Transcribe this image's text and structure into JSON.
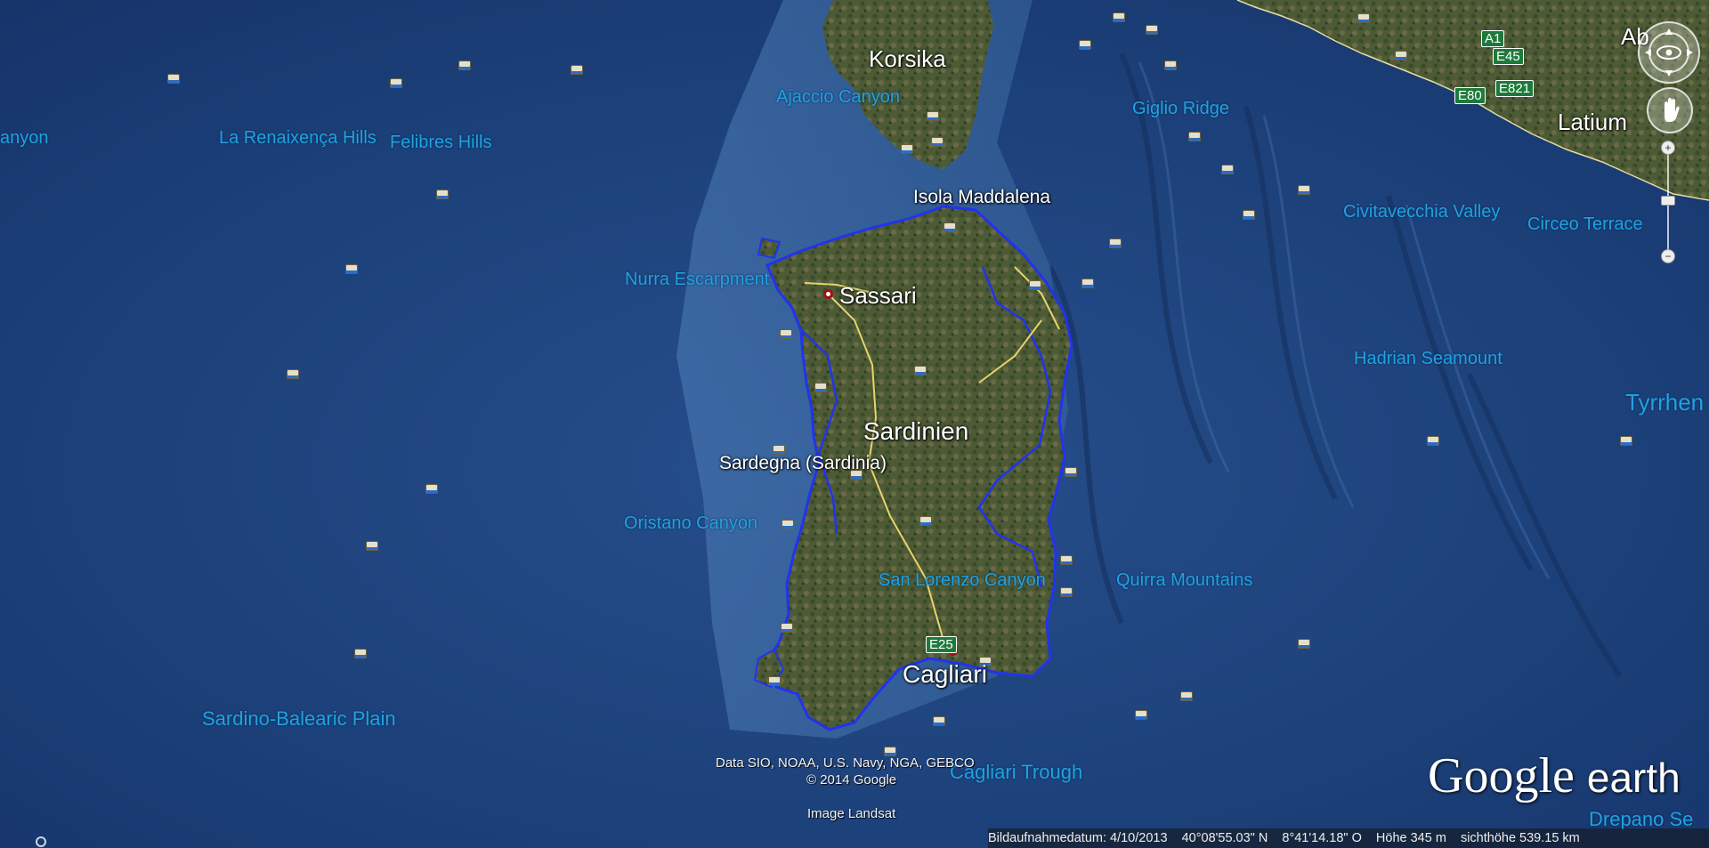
{
  "window": {
    "title": "Google Earth"
  },
  "map": {
    "country_labels": [
      {
        "id": "sardinien",
        "text": "Sardinien"
      },
      {
        "id": "korsika",
        "text": "Korsika"
      },
      {
        "id": "latium",
        "text": "Latium"
      },
      {
        "id": "abruzzo-partial",
        "text": "Ab"
      }
    ],
    "city_labels": [
      {
        "id": "sassari",
        "text": "Sassari"
      },
      {
        "id": "cagliari",
        "text": "Cagliari"
      },
      {
        "id": "isola-maddalena",
        "text": "Isola Maddalena"
      },
      {
        "id": "sardegna",
        "text": "Sardegna (Sardinia)"
      }
    ],
    "undersea_labels": [
      {
        "id": "canyon-left",
        "text": "anyon"
      },
      {
        "id": "renaixenca",
        "text": "La Renaixença Hills"
      },
      {
        "id": "felibres",
        "text": "Felibres Hills"
      },
      {
        "id": "ajaccio",
        "text": "Ajaccio Canyon"
      },
      {
        "id": "giglio",
        "text": "Giglio Ridge"
      },
      {
        "id": "civitavecchia",
        "text": "Civitavecchia Valley"
      },
      {
        "id": "circeo",
        "text": "Circeo Terrace"
      },
      {
        "id": "nurra",
        "text": "Nurra Escarpment"
      },
      {
        "id": "hadrian",
        "text": "Hadrian Seamount"
      },
      {
        "id": "tyrrhen",
        "text": "Tyrrhen"
      },
      {
        "id": "oristano",
        "text": "Oristano Canyon"
      },
      {
        "id": "san-lorenzo",
        "text": "San Lorenzo Canyon"
      },
      {
        "id": "quirra",
        "text": "Quirra Mountains"
      },
      {
        "id": "sardino-balearic",
        "text": "Sardino-Balearic Plain"
      },
      {
        "id": "cagliari-trough",
        "text": "Cagliari Trough"
      },
      {
        "id": "drepano",
        "text": "Drepano Se"
      }
    ],
    "road_shields": [
      "A1",
      "E45",
      "E821",
      "E80",
      "E25"
    ],
    "attribution": {
      "data": "Data SIO, NOAA, U.S. Navy, NGA, GEBCO",
      "copyright": "© 2014 Google",
      "imagery": "Image Landsat"
    },
    "logo": {
      "brand": "Google",
      "product": "earth"
    }
  },
  "status_bar": {
    "capture_date": "Bildaufnahmedatum: 4/10/2013",
    "latitude": "40°08'55.03\" N",
    "longitude": "8°41'14.18\" O",
    "elevation": "Höhe   345 m",
    "eye_altitude": "sichthöhe 539.15 km"
  },
  "nav_controls": {
    "look_icon": "eye-icon",
    "move_icon": "hand-icon",
    "zoom_in": "+",
    "zoom_out": "−"
  },
  "colors": {
    "sea": "#1b3f7a",
    "land": "#4a5a34",
    "border": "#2233ee",
    "sea_label": "#1fa3e0"
  }
}
